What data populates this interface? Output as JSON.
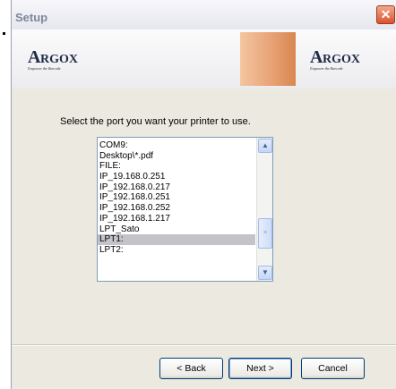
{
  "window": {
    "title": "Setup",
    "close_glyph": "✕"
  },
  "banner": {
    "logo_left": {
      "first": "A",
      "rest": "RGOX",
      "tagline": "Empower the Barcode"
    },
    "logo_right": {
      "first": "A",
      "rest": "RGOX",
      "tagline": "Empower the Barcode"
    },
    "accent_color": "#e8a377"
  },
  "prompt": "Select the port you want your printer to use.",
  "ports": {
    "items": [
      "COM9:",
      "Desktop\\*.pdf",
      "FILE:",
      "IP_19.168.0.251",
      "IP_192.168.0.217",
      "IP_192.168.0.251",
      "IP_192.168.0.252",
      "IP_192.168.1.217",
      "LPT_Sato",
      "LPT1:",
      "LPT2:"
    ],
    "selected": "LPT1:"
  },
  "buttons": {
    "back": "< Back",
    "next": "Next >",
    "cancel": "Cancel"
  }
}
